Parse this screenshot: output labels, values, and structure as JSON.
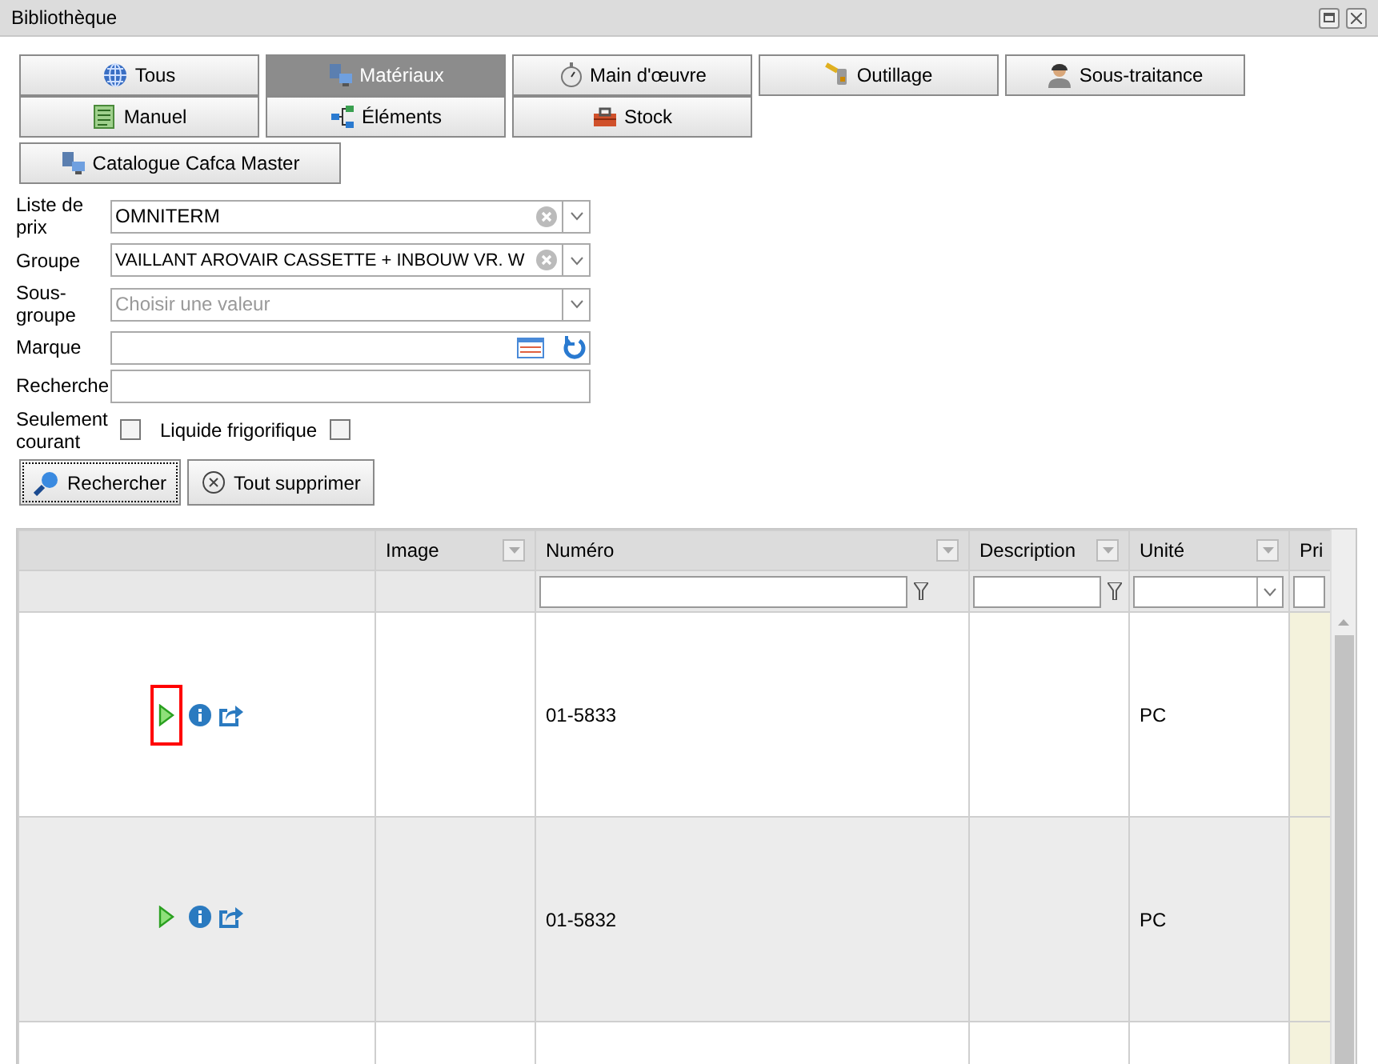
{
  "window": {
    "title": "Bibliothèque"
  },
  "tab_rows": [
    [
      {
        "label": "Tous",
        "kind": "globe",
        "selected": false
      },
      {
        "label": "Matériaux",
        "kind": "computers",
        "selected": true
      },
      {
        "label": "Main d'œuvre",
        "kind": "stopwatch",
        "selected": false
      },
      {
        "label": "Outillage",
        "kind": "hammer",
        "selected": false
      },
      {
        "label": "Sous-traitance",
        "kind": "person",
        "selected": false
      }
    ],
    [
      {
        "label": "Manuel",
        "kind": "document",
        "selected": false
      },
      {
        "label": "Éléments",
        "kind": "tree",
        "selected": false
      },
      {
        "label": "Stock",
        "kind": "toolbox",
        "selected": false
      }
    ],
    [
      {
        "label": "Catalogue Cafca Master",
        "kind": "computers",
        "selected": false
      }
    ]
  ],
  "form": {
    "fields": [
      {
        "label": "Liste de prix",
        "kind": "select",
        "value": "OMNITERM",
        "clearable": true
      },
      {
        "label": "Groupe",
        "kind": "select",
        "value": "VAILLANT AROVAIR CASSETTE + INBOUW VR. W",
        "clearable": true
      },
      {
        "label": "Sous-groupe",
        "kind": "select",
        "placeholder": "Choisir une valeur",
        "clearable": false
      },
      {
        "label": "Marque",
        "kind": "picker"
      },
      {
        "label": "Recherche",
        "kind": "text"
      }
    ],
    "checkboxes": [
      {
        "label": "Seulement courant",
        "checked": false
      },
      {
        "label": "Liquide frigorifique",
        "checked": false
      }
    ],
    "buttons": [
      {
        "label": "Rechercher",
        "kind": "search",
        "focused": true
      },
      {
        "label": "Tout supprimer",
        "kind": "clear",
        "focused": false
      }
    ]
  },
  "table": {
    "columns": [
      {
        "kind": "none"
      },
      {
        "label": "Image",
        "kind": "none"
      },
      {
        "label": "Numéro",
        "kind": "text"
      },
      {
        "label": "Description",
        "kind": "text"
      },
      {
        "label": "Unité",
        "kind": "select"
      },
      {
        "label": "Pri",
        "kind": "plain"
      }
    ],
    "rows": [
      {
        "shaded": false,
        "highlighted": true,
        "numero": "01-5833",
        "unite": "PC"
      },
      {
        "shaded": true,
        "highlighted": false,
        "numero": "01-5832",
        "unite": "PC"
      },
      {
        "shaded": false,
        "highlighted": false
      }
    ]
  }
}
